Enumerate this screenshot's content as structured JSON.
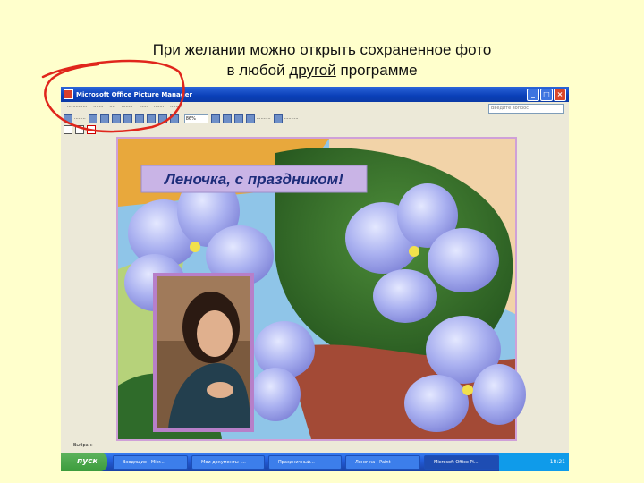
{
  "caption": {
    "line1": "При желании можно открыть сохраненное фото",
    "line2_before": "в любой ",
    "line2_underlined": "другой",
    "line2_after": " программе"
  },
  "window": {
    "title": "Microsoft Office Picture Manager",
    "help_placeholder": "Введите вопрос",
    "zoom": "86%"
  },
  "photo": {
    "greeting": "Леночка, с праздником!"
  },
  "statusbar": {
    "text": "Выбран:"
  },
  "taskbar": {
    "start_label": "пуск",
    "clock": "18:21",
    "tasks": [
      "Входящие - Micr...",
      "Мои документы -...",
      "Праздничный...",
      "Леночка - Paint",
      "Microsoft Office Pi..."
    ]
  },
  "colors": {
    "slide_bg": "#FFFFCC",
    "annotation": "#E0261C",
    "title_bar": "#0A3FB8"
  }
}
